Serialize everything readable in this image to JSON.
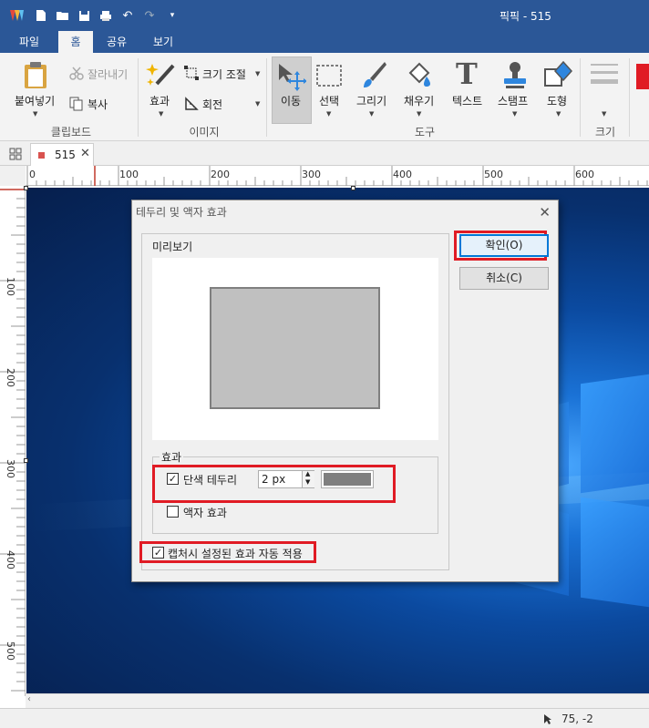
{
  "window": {
    "title": "픽픽 - 515"
  },
  "menu": {
    "tabs": [
      "파일",
      "홈",
      "공유",
      "보기"
    ],
    "active_index": 1
  },
  "ribbon": {
    "clipboard": {
      "paste": "붙여넣기",
      "cut": "잘라내기",
      "copy": "복사",
      "group": "클립보드"
    },
    "image": {
      "effects": "효과",
      "resize": "크기 조절",
      "rotate": "회전",
      "group": "이미지"
    },
    "tools": {
      "move": "이동",
      "select": "선택",
      "draw": "그리기",
      "fill": "채우기",
      "text": "텍스트",
      "stamp": "스탬프",
      "shape": "도형",
      "group": "도구"
    },
    "size": {
      "group": "크기"
    }
  },
  "doc_tab": {
    "label": "515"
  },
  "ruler": {
    "h_labels": [
      "0",
      "100",
      "200",
      "300",
      "400",
      "500",
      "600"
    ],
    "v_labels": [
      "100",
      "200",
      "300",
      "400",
      "500"
    ]
  },
  "dialog": {
    "title": "테두리 및 액자 효과",
    "preview_label": "미리보기",
    "ok_label": "확인(O)",
    "cancel_label": "취소(C)",
    "effects_group": "효과",
    "solid_border_label": "단색 테두리",
    "solid_border_checked": true,
    "border_width_value": "2 px",
    "border_color": "#7f7f7f",
    "frame_effect_label": "액자 효과",
    "frame_effect_checked": false,
    "auto_apply_label": "캡처시 설정된 효과 자동 적용",
    "auto_apply_checked": true
  },
  "status": {
    "coords": "75, -2"
  },
  "colors": {
    "title_bar": "#2b5797",
    "highlight": "#e01b24",
    "accent": "#0078d7"
  }
}
